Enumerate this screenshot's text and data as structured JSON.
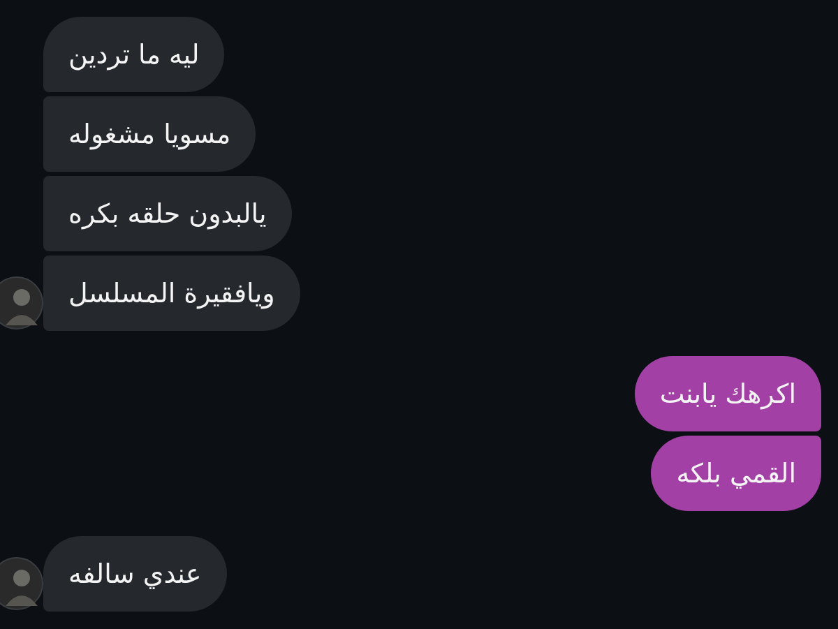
{
  "messages": [
    {
      "text": "ليه ما تردين",
      "outgoing": false,
      "avatar": false
    },
    {
      "text": "مسويا مشغوله",
      "outgoing": false,
      "avatar": false
    },
    {
      "text": "يالبدون حلقه بكره",
      "outgoing": false,
      "avatar": false
    },
    {
      "text": "ويافقيرة المسلسل",
      "outgoing": false,
      "avatar": true
    },
    {
      "text": "اكرهك يابنت",
      "outgoing": true,
      "avatar": false
    },
    {
      "text": "القمي بلكه",
      "outgoing": true,
      "avatar": false
    },
    {
      "text": "عندي سالفه",
      "outgoing": false,
      "avatar": true
    }
  ]
}
